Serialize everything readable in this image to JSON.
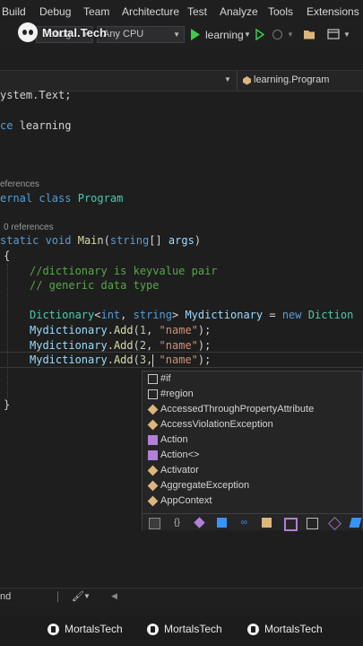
{
  "menu": [
    "Build",
    "Debug",
    "Team",
    "Architecture",
    "Test",
    "Analyze",
    "Tools",
    "Extensions"
  ],
  "toolbar": {
    "config": "Debug",
    "platform": "Any CPU",
    "run_target": "learning"
  },
  "watermark": "Mortal.Tech",
  "navbar": {
    "scope": "learning.Program"
  },
  "code": {
    "using": "ystem.Text;",
    "ns_kw": "ce",
    "ns_name": "learning",
    "refs1": "eferences",
    "class_kw": "ernal class",
    "class_name": "Program",
    "refs2": "0 references",
    "main_kw": "static void",
    "main_name": "Main",
    "main_params_a": "(",
    "main_params_type": "string",
    "main_params_b": "[] ",
    "main_params_id": "args",
    "main_params_c": ")",
    "brace_open": "{",
    "comment1": "//dictionary is keyvalue pair",
    "comment2": "// generic data type",
    "dict_type": "Dictionary",
    "dict_gen_a": "<",
    "dict_gen_int": "int",
    "dict_gen_sep": ", ",
    "dict_gen_str": "string",
    "dict_gen_b": "> ",
    "dict_var": "Mydictionary",
    "dict_eq": " = ",
    "dict_new": "new",
    "dict_rest": " Diction",
    "add_obj": "Mydictionary",
    "add_dot": ".",
    "add_fn": "Add",
    "add1_a": "(",
    "add1_num": "1",
    "add1_b": ", ",
    "add_str": "\"name\"",
    "add_end": ");",
    "add2_num": "2",
    "add3_num": "3",
    "brace_close": "}"
  },
  "completion": {
    "items": [
      "#if",
      "#region",
      "AccessedThroughPropertyAttribute",
      "AccessViolationException",
      "Action",
      "Action<>",
      "Activator",
      "AggregateException",
      "AppContext"
    ],
    "filter_icons": [
      "snippet-filter-icon",
      "namespace-filter-icon",
      "method-filter-icon",
      "class-filter-icon",
      "interface-filter-icon",
      "enum-filter-icon",
      "struct-filter-icon",
      "delegate-filter-icon",
      "constant-filter-icon",
      "extension-filter-icon"
    ]
  },
  "statusbar": {
    "left_text": "nd"
  },
  "footer": {
    "facebook": "MortalsTech",
    "instagram": "MortalsTech",
    "twitter": "MortalsTech"
  },
  "colors": {
    "keyword": "#569cd6",
    "type": "#4ec9b0",
    "method": "#dcdcaa",
    "string": "#ce9178",
    "comment": "#57a64a",
    "identifier": "#9cdcfe",
    "number": "#b5cea8",
    "run_button": "#3ec94b"
  }
}
